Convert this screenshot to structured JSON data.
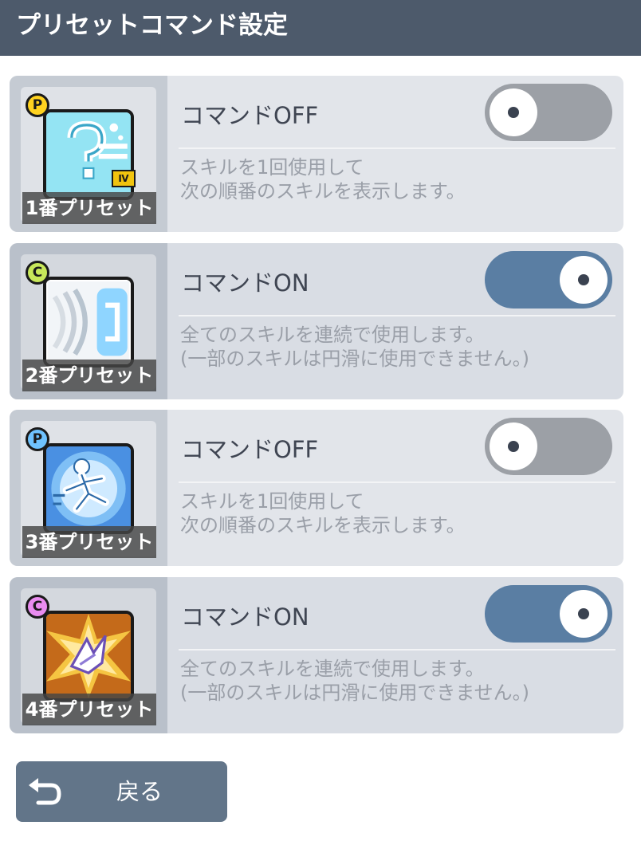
{
  "header": {
    "title": "プリセットコマンド設定"
  },
  "presets": [
    {
      "badge": "P",
      "label": "1番プリセット",
      "command": "コマンドOFF",
      "on": false,
      "desc_line1": "スキルを1回使用して",
      "desc_line2": "次の順番のスキルを表示します。",
      "rank_badge": "Ⅳ"
    },
    {
      "badge": "C",
      "label": "2番プリセット",
      "command": "コマンドON",
      "on": true,
      "desc_line1": "全てのスキルを連続で使用します。",
      "desc_line2": "(一部のスキルは円滑に使用できません。)"
    },
    {
      "badge": "P",
      "label": "3番プリセット",
      "command": "コマンドOFF",
      "on": false,
      "desc_line1": "スキルを1回使用して",
      "desc_line2": "次の順番のスキルを表示します。"
    },
    {
      "badge": "C",
      "label": "4番プリセット",
      "command": "コマンドON",
      "on": true,
      "desc_line1": "全てのスキルを連続で使用します。",
      "desc_line2": "(一部のスキルは円滑に使用できません。)"
    }
  ],
  "footer": {
    "back_label": "戻る"
  },
  "colors": {
    "header": "#4d5a6b",
    "toggle_on": "#5a7ea3",
    "toggle_off": "#9ca0a6",
    "back_button": "#627589"
  },
  "icons": [
    "return-arrow-icon",
    "toggle-knob-icon"
  ]
}
